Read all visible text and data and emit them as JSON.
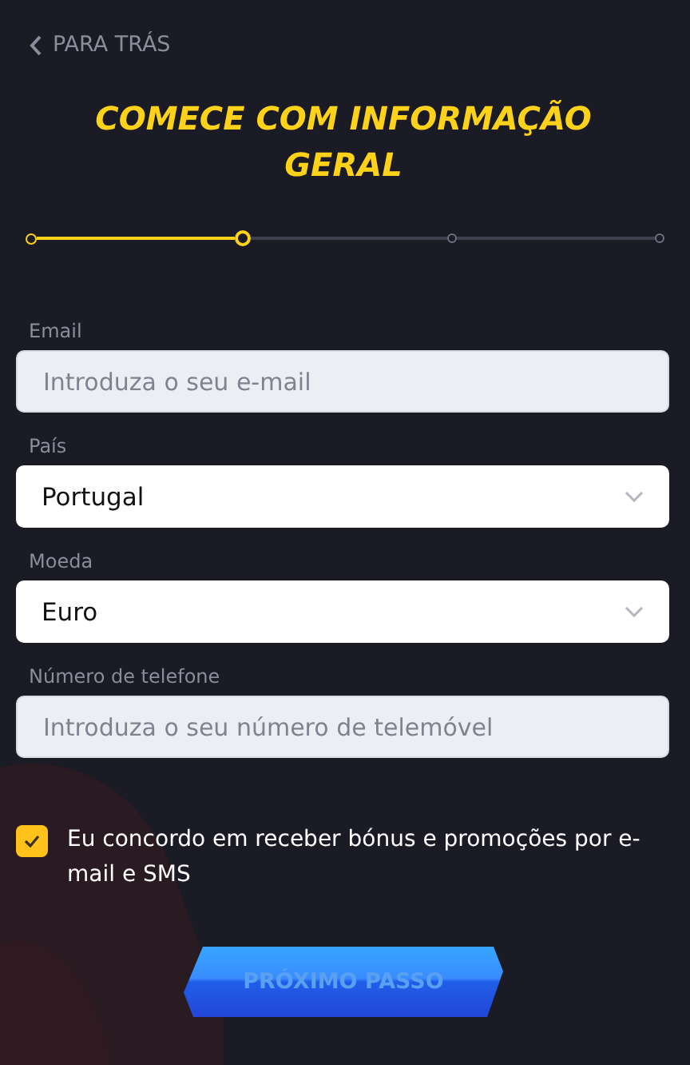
{
  "back_link": {
    "label": "PARA TRÁS"
  },
  "title": "COMECE COM INFORMAÇÃO GERAL",
  "steps": [
    {
      "kind": "done"
    },
    {
      "kind": "current"
    },
    {
      "kind": "todo"
    },
    {
      "kind": "todo"
    }
  ],
  "fields": [
    {
      "kind": "input",
      "label": "Email",
      "placeholder": "Introduza o seu e-mail"
    },
    {
      "kind": "select",
      "label": "País",
      "value": "Portugal"
    },
    {
      "kind": "select",
      "label": "Moeda",
      "value": "Euro"
    },
    {
      "kind": "input",
      "label": "Número de telefone",
      "placeholder": "Introduza o seu número de telemóvel"
    }
  ],
  "consent": {
    "checked": true,
    "label": "Eu concordo em receber bónus e promoções por e-mail e SMS"
  },
  "next_button": {
    "label": "PRÓXIMO PASSO",
    "disabled": true
  }
}
